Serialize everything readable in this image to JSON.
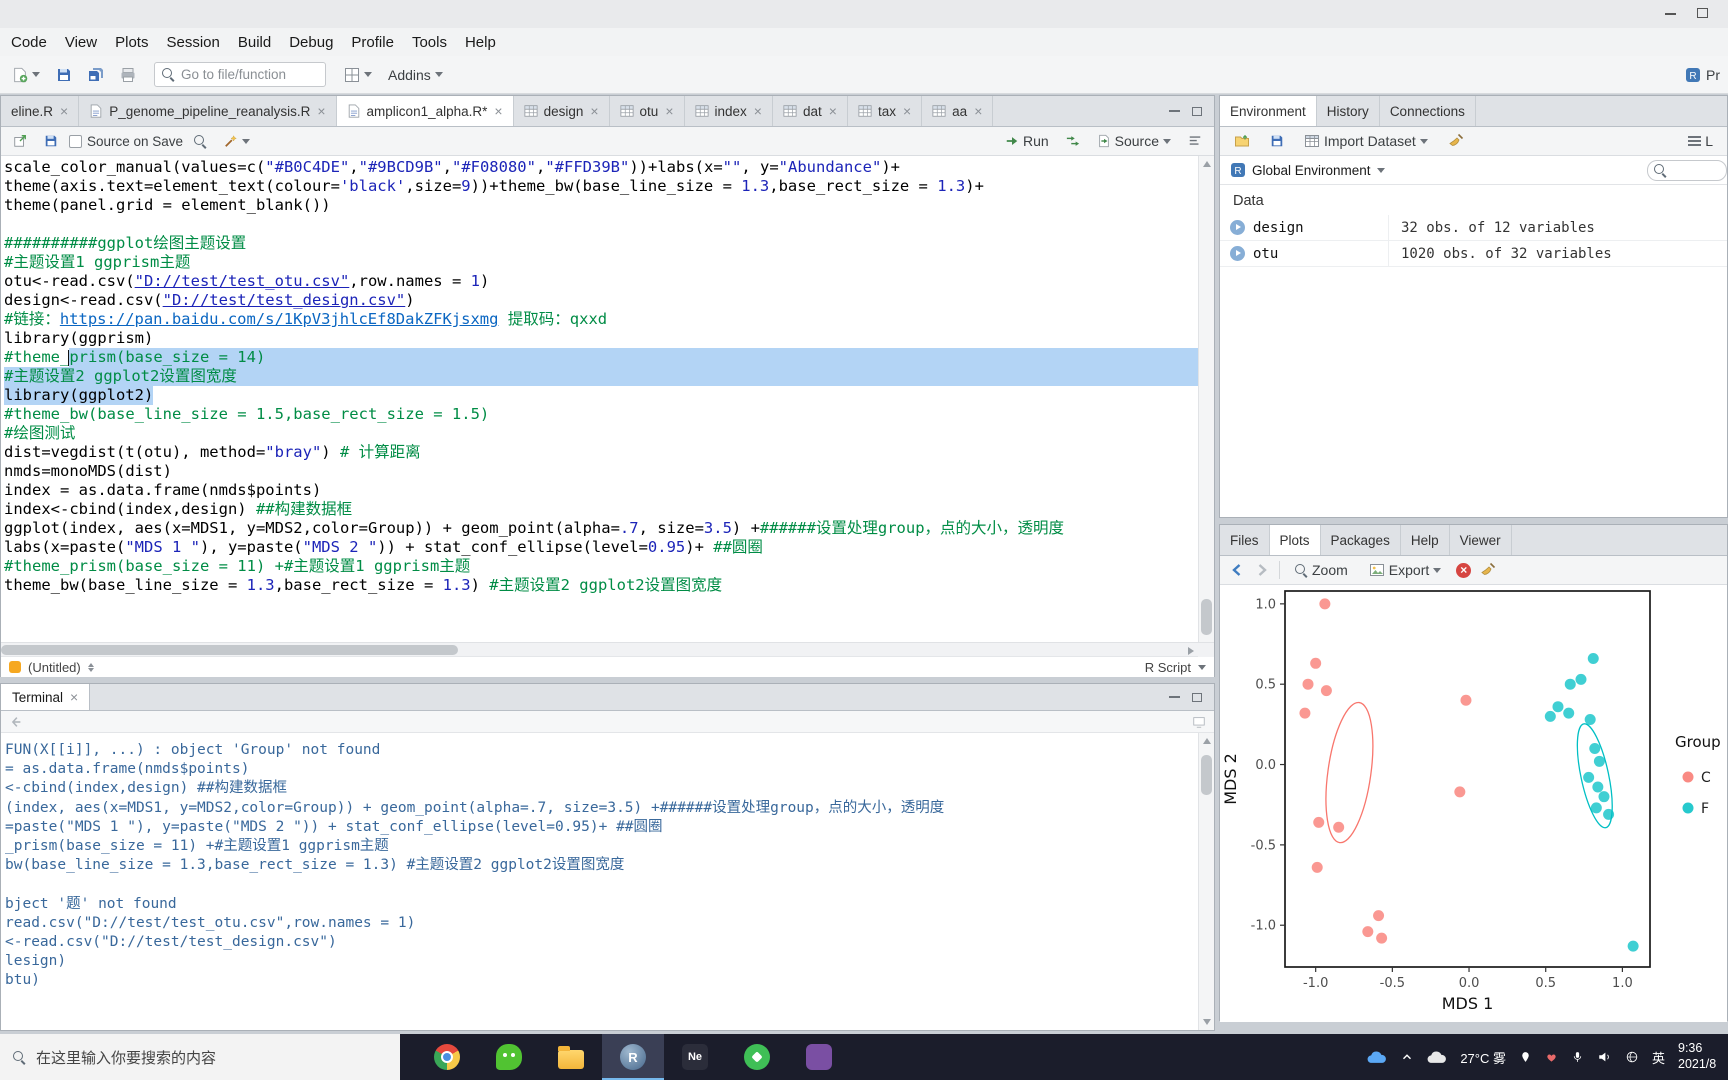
{
  "menu": {
    "items": [
      "Code",
      "View",
      "Plots",
      "Session",
      "Build",
      "Debug",
      "Profile",
      "Tools",
      "Help"
    ]
  },
  "toolbar": {
    "goto_placeholder": "Go to file/function",
    "addins_label": "Addins",
    "project_label": "Pr"
  },
  "editor": {
    "tabs": [
      {
        "label": "eline.R",
        "type": "r",
        "icon": false
      },
      {
        "label": "P_genome_pipeline_reanalysis.R",
        "type": "r"
      },
      {
        "label": "amplicon1_alpha.R*",
        "type": "r",
        "active": true
      },
      {
        "label": "design",
        "type": "data"
      },
      {
        "label": "otu",
        "type": "data"
      },
      {
        "label": "index",
        "type": "data"
      },
      {
        "label": "dat",
        "type": "data"
      },
      {
        "label": "tax",
        "type": "data"
      },
      {
        "label": "aa",
        "type": "data"
      }
    ],
    "toolbar": {
      "source_on_save": "Source on Save",
      "run_label": "Run",
      "source_label": "Source"
    },
    "status": {
      "name": "(Untitled)",
      "type": "R Script"
    },
    "lines": [
      {
        "p": [
          [
            "t",
            "scale_color_manual(values=c("
          ],
          [
            "s",
            "\"#B0C4DE\""
          ],
          [
            "t",
            ","
          ],
          [
            "s",
            "\"#9BCD9B\""
          ],
          [
            "t",
            ","
          ],
          [
            "s",
            "\"#F08080\""
          ],
          [
            "t",
            ","
          ],
          [
            "s",
            "\"#FFD39B\""
          ],
          [
            "t",
            "))+labs(x="
          ],
          [
            "s",
            "\"\""
          ],
          [
            "t",
            ", y="
          ],
          [
            "s",
            "\"Abundance\""
          ],
          [
            "t",
            ")+"
          ]
        ]
      },
      {
        "p": [
          [
            "t",
            "theme(axis.text=element_text(colour="
          ],
          [
            "s",
            "'black'"
          ],
          [
            "t",
            ",size="
          ],
          [
            "n",
            "9"
          ],
          [
            "t",
            "))+theme_bw(base_line_size = "
          ],
          [
            "n",
            "1.3"
          ],
          [
            "t",
            ",base_rect_size = "
          ],
          [
            "n",
            "1.3"
          ],
          [
            "t",
            ")+"
          ]
        ]
      },
      {
        "p": [
          [
            "t",
            "theme(panel.grid = element_blank())"
          ]
        ]
      },
      {
        "p": []
      },
      {
        "p": [
          [
            "c",
            "##########ggplot绘图主题设置"
          ]
        ]
      },
      {
        "p": [
          [
            "c",
            "#主题设置1 ggprism主题"
          ]
        ]
      },
      {
        "p": [
          [
            "t",
            "otu<-read.csv("
          ],
          [
            "su",
            "\"D://test/test_otu.csv\""
          ],
          [
            "t",
            ",row.names = "
          ],
          [
            "n",
            "1"
          ],
          [
            "t",
            ")"
          ]
        ]
      },
      {
        "p": [
          [
            "t",
            "design<-read.csv("
          ],
          [
            "su",
            "\"D://test/test_design.csv\""
          ],
          [
            "t",
            ")"
          ]
        ]
      },
      {
        "p": [
          [
            "c",
            "#链接："
          ],
          [
            "link",
            "https://pan.baidu.com/s/1KpV3jhlcEf8DakZFKjsxmg"
          ],
          [
            "c",
            " 提取码：qxxd"
          ]
        ]
      },
      {
        "p": [
          [
            "t",
            "library(ggprism)"
          ]
        ]
      },
      {
        "p": [
          [
            "c",
            "#theme_"
          ],
          [
            "caret",
            ""
          ],
          [
            "c sel",
            "prism(base_size = 14)"
          ]
        ],
        "tail": true
      },
      {
        "p": [
          [
            "c sel",
            "#主题设置2 ggplot2设置图宽度"
          ]
        ],
        "tail": true
      },
      {
        "p": [
          [
            "t sel",
            "library(ggplot2)"
          ]
        ]
      },
      {
        "p": [
          [
            "c",
            "#theme_bw(base_line_size = 1.5,base_rect_size = 1.5)"
          ]
        ]
      },
      {
        "p": [
          [
            "c",
            "#绘图测试"
          ]
        ]
      },
      {
        "p": [
          [
            "t",
            "dist=vegdist(t(otu), method="
          ],
          [
            "s",
            "\"bray\""
          ],
          [
            "t",
            ") "
          ],
          [
            "c",
            "# 计算距离"
          ]
        ]
      },
      {
        "p": [
          [
            "t",
            "nmds=monoMDS(dist)"
          ]
        ]
      },
      {
        "p": [
          [
            "t",
            "index = as.data.frame(nmds$points)"
          ]
        ]
      },
      {
        "p": [
          [
            "t",
            "index<-cbind(index,design) "
          ],
          [
            "c",
            "##构建数据框"
          ]
        ]
      },
      {
        "p": [
          [
            "t",
            "ggplot(index, aes(x=MDS1, y=MDS2,color=Group)) + geom_point(alpha="
          ],
          [
            "n",
            ".7"
          ],
          [
            "t",
            ", size="
          ],
          [
            "n",
            "3.5"
          ],
          [
            "t",
            ") +"
          ],
          [
            "c",
            "######设置处理group，点的大小，透明度"
          ]
        ]
      },
      {
        "p": [
          [
            "t",
            "labs(x=paste("
          ],
          [
            "s",
            "\"MDS 1 \""
          ],
          [
            "t",
            "), y=paste("
          ],
          [
            "s",
            "\"MDS 2 \""
          ],
          [
            "t",
            ")) + stat_conf_ellipse(level="
          ],
          [
            "n",
            "0.95"
          ],
          [
            "t",
            ")+ "
          ],
          [
            "c",
            "##圆圈"
          ]
        ]
      },
      {
        "p": [
          [
            "c",
            "#theme_prism(base_size = 11) +#主题设置1 ggprism主题"
          ]
        ]
      },
      {
        "p": [
          [
            "t",
            "theme_bw(base_line_size = "
          ],
          [
            "n",
            "1.3"
          ],
          [
            "t",
            ",base_rect_size = "
          ],
          [
            "n",
            "1.3"
          ],
          [
            "t",
            ") "
          ],
          [
            "c",
            "#主题设置2 ggplot2设置图宽度"
          ]
        ]
      }
    ]
  },
  "terminal": {
    "title": "Terminal",
    "lines": [
      "FUN(X[[i]], ...) : object 'Group' not found",
      "= as.data.frame(nmds$points)",
      "<-cbind(index,design) ##构建数据框",
      "(index, aes(x=MDS1, y=MDS2,color=Group)) + geom_point(alpha=.7, size=3.5) +######设置处理group，点的大小，透明度",
      "=paste(\"MDS 1 \"), y=paste(\"MDS 2 \")) + stat_conf_ellipse(level=0.95)+ ##圆圈",
      "_prism(base_size = 11) +#主题设置1 ggprism主题",
      "bw(base_line_size = 1.3,base_rect_size = 1.3) #主题设置2 ggplot2设置图宽度",
      "",
      "bject '题' not found",
      "read.csv(\"D://test/test_otu.csv\",row.names = 1)",
      "<-read.csv(\"D://test/test_design.csv\")",
      "lesign)",
      "btu)"
    ]
  },
  "environment": {
    "tabs": [
      "Environment",
      "History",
      "Connections"
    ],
    "toolbar": {
      "import_label": "Import Dataset",
      "list_label": "L"
    },
    "scope_label": "Global Environment",
    "section_label": "Data",
    "rows": [
      {
        "name": "design",
        "value": "32 obs. of 12 variables"
      },
      {
        "name": "otu",
        "value": "1020 obs. of 32 variables"
      }
    ]
  },
  "plots": {
    "tabs": [
      "Files",
      "Plots",
      "Packages",
      "Help",
      "Viewer"
    ],
    "toolbar": {
      "zoom_label": "Zoom",
      "export_label": "Export"
    }
  },
  "taskbar": {
    "search_placeholder": "在这里输入你要搜索的内容",
    "apps": [
      {
        "id": "chrome"
      },
      {
        "id": "wechat"
      },
      {
        "id": "explorer"
      },
      {
        "id": "rstudio",
        "glyph": "R",
        "active": true
      },
      {
        "id": "ne",
        "glyph": "Ne"
      },
      {
        "id": "greenapp"
      },
      {
        "id": "purpleapp"
      }
    ],
    "tray": {
      "weather": "27°C 雾",
      "lang": "英",
      "time": "9:36",
      "date": "2021/8"
    }
  },
  "chart_data": {
    "type": "scatter",
    "title": "",
    "xlabel": "MDS 1",
    "ylabel": "MDS 2",
    "xlim": [
      -1.2,
      1.18
    ],
    "ylim": [
      -1.26,
      1.08
    ],
    "xticks": [
      -1.0,
      -0.5,
      0.0,
      0.5,
      1.0
    ],
    "yticks": [
      -1.0,
      -0.5,
      0.0,
      0.5,
      1.0
    ],
    "grid": false,
    "legend": {
      "title": "Group",
      "position": "right",
      "entries": [
        {
          "label": "C",
          "color": "#F8766D"
        },
        {
          "label": "F",
          "color": "#00BFC4"
        }
      ]
    },
    "series": [
      {
        "name": "C",
        "color": "#F8766D",
        "points": [
          [
            -0.94,
            1.0
          ],
          [
            -1.0,
            0.63
          ],
          [
            -1.05,
            0.5
          ],
          [
            -0.93,
            0.46
          ],
          [
            -1.07,
            0.32
          ],
          [
            -0.02,
            0.4
          ],
          [
            -0.06,
            -0.17
          ],
          [
            -0.98,
            -0.36
          ],
          [
            -0.85,
            -0.39
          ],
          [
            -0.99,
            -0.64
          ],
          [
            -0.59,
            -0.94
          ],
          [
            -0.66,
            -1.04
          ],
          [
            -0.57,
            -1.08
          ]
        ],
        "ellipse": {
          "cx": -0.78,
          "cy": -0.05,
          "rx": 0.14,
          "ry": 0.44,
          "angle": 8
        }
      },
      {
        "name": "F",
        "color": "#00BFC4",
        "points": [
          [
            0.81,
            0.66
          ],
          [
            0.73,
            0.53
          ],
          [
            0.66,
            0.5
          ],
          [
            0.58,
            0.36
          ],
          [
            0.65,
            0.32
          ],
          [
            0.53,
            0.3
          ],
          [
            0.79,
            0.28
          ],
          [
            0.82,
            0.1
          ],
          [
            0.85,
            0.02
          ],
          [
            0.78,
            -0.08
          ],
          [
            0.84,
            -0.14
          ],
          [
            0.88,
            -0.2
          ],
          [
            0.83,
            -0.27
          ],
          [
            0.91,
            -0.31
          ],
          [
            1.07,
            -1.13
          ]
        ],
        "ellipse": {
          "cx": 0.82,
          "cy": -0.07,
          "rx": 0.09,
          "ry": 0.33,
          "angle": -12
        }
      }
    ]
  },
  "colors": {
    "selection": "#b3d4f5",
    "comment": "#008c45",
    "string": "#1c24b8",
    "point_red": "#F8766D",
    "point_teal": "#00BFC4"
  }
}
